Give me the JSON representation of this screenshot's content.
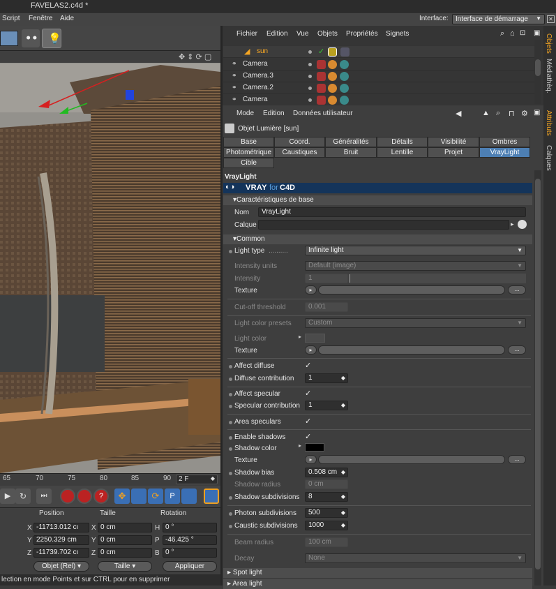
{
  "window": {
    "title": "FAVELAS2.c4d *"
  },
  "menubar": {
    "items": [
      "Script",
      "Fenêtre",
      "Aide"
    ],
    "interface_label": "Interface:",
    "interface_value": "Interface de démarrage"
  },
  "timeline": {
    "ticks": [
      "65",
      "70",
      "75",
      "80",
      "85",
      "90"
    ],
    "frame": "2 F"
  },
  "coords": {
    "headers": [
      "Position",
      "Taille",
      "Rotation"
    ],
    "rows": [
      {
        "axis": "X",
        "pos": "-11713.012 cı",
        "size_axis": "X",
        "size": "0 cm",
        "rot_axis": "H",
        "rot": "0 °"
      },
      {
        "axis": "Y",
        "pos": "2250.329 cm",
        "size_axis": "Y",
        "size": "0 cm",
        "rot_axis": "P",
        "rot": "-46.425 °"
      },
      {
        "axis": "Z",
        "pos": "-11739.702 cı",
        "size_axis": "Z",
        "size": "0 cm",
        "rot_axis": "B",
        "rot": "0 °"
      }
    ],
    "mode_select": "Objet (Rel)",
    "size_select": "Taille",
    "apply_label": "Appliquer"
  },
  "status": {
    "text": "lection en mode Points et sur CTRL pour en supprimer"
  },
  "objmgr": {
    "menu": [
      "Fichier",
      "Edition",
      "Vue",
      "Objets",
      "Propriétés",
      "Signets"
    ],
    "objects": [
      "sun",
      "Camera",
      "Camera.3",
      "Camera.2",
      "Camera"
    ]
  },
  "attr": {
    "menu": [
      "Mode",
      "Edition",
      "Données utilisateur"
    ],
    "object_title": "Objet Lumière [sun]",
    "tabs_row1": [
      "Base",
      "Coord.",
      "Généralités",
      "Détails",
      "Visibilité",
      "Ombres"
    ],
    "tabs_row2": [
      "Photométrique",
      "Caustiques",
      "Bruit",
      "Lentille",
      "Projet",
      "VrayLight"
    ],
    "tabs_row3": [
      "Cible"
    ],
    "section_title": "VrayLight",
    "banner": {
      "vray": "VRAY",
      "for": "for",
      "c4d": "C4D"
    },
    "basic_section": "Caractéristiques de base",
    "name_label": "Nom",
    "name_value": "VrayLight",
    "layer_label": "Calque",
    "common_section": "Common",
    "light_type_label": "Light type",
    "light_type_value": "Infinite light",
    "intensity_units_label": "Intensity units",
    "intensity_units_value": "Default (image)",
    "intensity_label": "Intensity",
    "intensity_value": "1",
    "texture_label": "Texture",
    "cutoff_label": "Cut-off threshold",
    "cutoff_value": "0.001",
    "color_presets_label": "Light color presets",
    "color_presets_value": "Custom",
    "light_color_label": "Light color",
    "texture2_label": "Texture",
    "affect_diffuse_label": "Affect diffuse",
    "diffuse_contrib_label": "Diffuse contribution",
    "diffuse_contrib_value": "1",
    "affect_specular_label": "Affect specular",
    "specular_contrib_label": "Specular contribution",
    "specular_contrib_value": "1",
    "area_specular_label": "Area speculars",
    "enable_shadows_label": "Enable shadows",
    "shadow_color_label": "Shadow color",
    "texture3_label": "Texture",
    "shadow_bias_label": "Shadow bias",
    "shadow_bias_value": "0.508 cm",
    "shadow_radius_label": "Shadow radius",
    "shadow_radius_value": "0 cm",
    "shadow_subdiv_label": "Shadow subdivisions",
    "shadow_subdiv_value": "8",
    "photon_subdiv_label": "Photon subdivisions",
    "photon_subdiv_value": "500",
    "caustic_subdiv_label": "Caustic subdivisions",
    "caustic_subdiv_value": "1000",
    "beam_radius_label": "Beam radius",
    "beam_radius_value": "100 cm",
    "decay_label": "Decay",
    "decay_value": "None",
    "spot_section": "Spot light",
    "area_section": "Area light",
    "dots": "...",
    "checkmark": "✓"
  },
  "sidetabs": [
    "Objets",
    "Médiathèq.",
    "Attributs",
    "Calques"
  ],
  "colors": {
    "accent_tab": "#4d7fb3",
    "banner": "#14345a",
    "selected_name": "#f5a623"
  }
}
